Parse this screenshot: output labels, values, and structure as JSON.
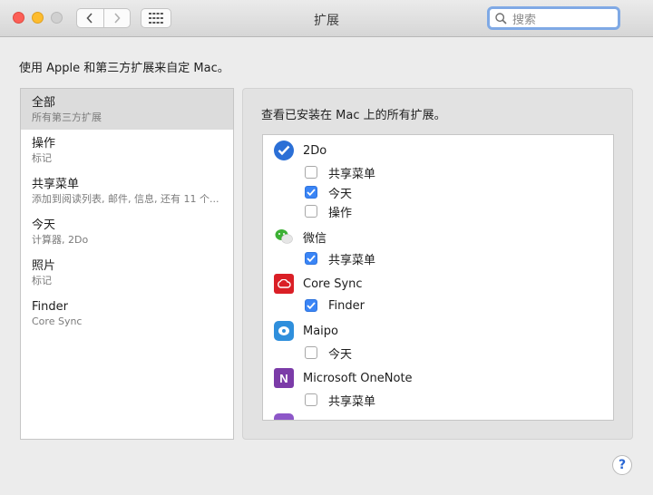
{
  "window": {
    "title": "扩展",
    "search_placeholder": "搜索"
  },
  "description": "使用 Apple 和第三方扩展来自定 Mac。",
  "categories": [
    {
      "title": "全部",
      "subtitle": "所有第三方扩展",
      "selected": true
    },
    {
      "title": "操作",
      "subtitle": "标记"
    },
    {
      "title": "共享菜单",
      "subtitle": "添加到阅读列表, 邮件, 信息, 还有 11 个..."
    },
    {
      "title": "今天",
      "subtitle": "计算器, 2Do"
    },
    {
      "title": "照片",
      "subtitle": "标记"
    },
    {
      "title": "Finder",
      "subtitle": "Core Sync"
    }
  ],
  "detail": {
    "heading": "查看已安装在 Mac 上的所有扩展。",
    "apps": [
      {
        "name": "2Do",
        "icon": "2do-app-icon",
        "options": [
          {
            "label": "共享菜单",
            "checked": false
          },
          {
            "label": "今天",
            "checked": true
          },
          {
            "label": "操作",
            "checked": false
          }
        ]
      },
      {
        "name": "微信",
        "icon": "wechat-app-icon",
        "options": [
          {
            "label": "共享菜单",
            "checked": true
          }
        ]
      },
      {
        "name": "Core Sync",
        "icon": "creative-cloud-app-icon",
        "options": [
          {
            "label": "Finder",
            "checked": true
          }
        ]
      },
      {
        "name": "Maipo",
        "icon": "maipo-app-icon",
        "options": [
          {
            "label": "今天",
            "checked": false
          }
        ]
      },
      {
        "name": "Microsoft OneNote",
        "icon": "onenote-app-icon",
        "options": [
          {
            "label": "共享菜单",
            "checked": false
          }
        ]
      }
    ]
  },
  "colors": {
    "checkbox_checked": "#3a85f6",
    "selected_row": "#dcdcdc",
    "search_focus_ring": "#7fa9e5"
  }
}
